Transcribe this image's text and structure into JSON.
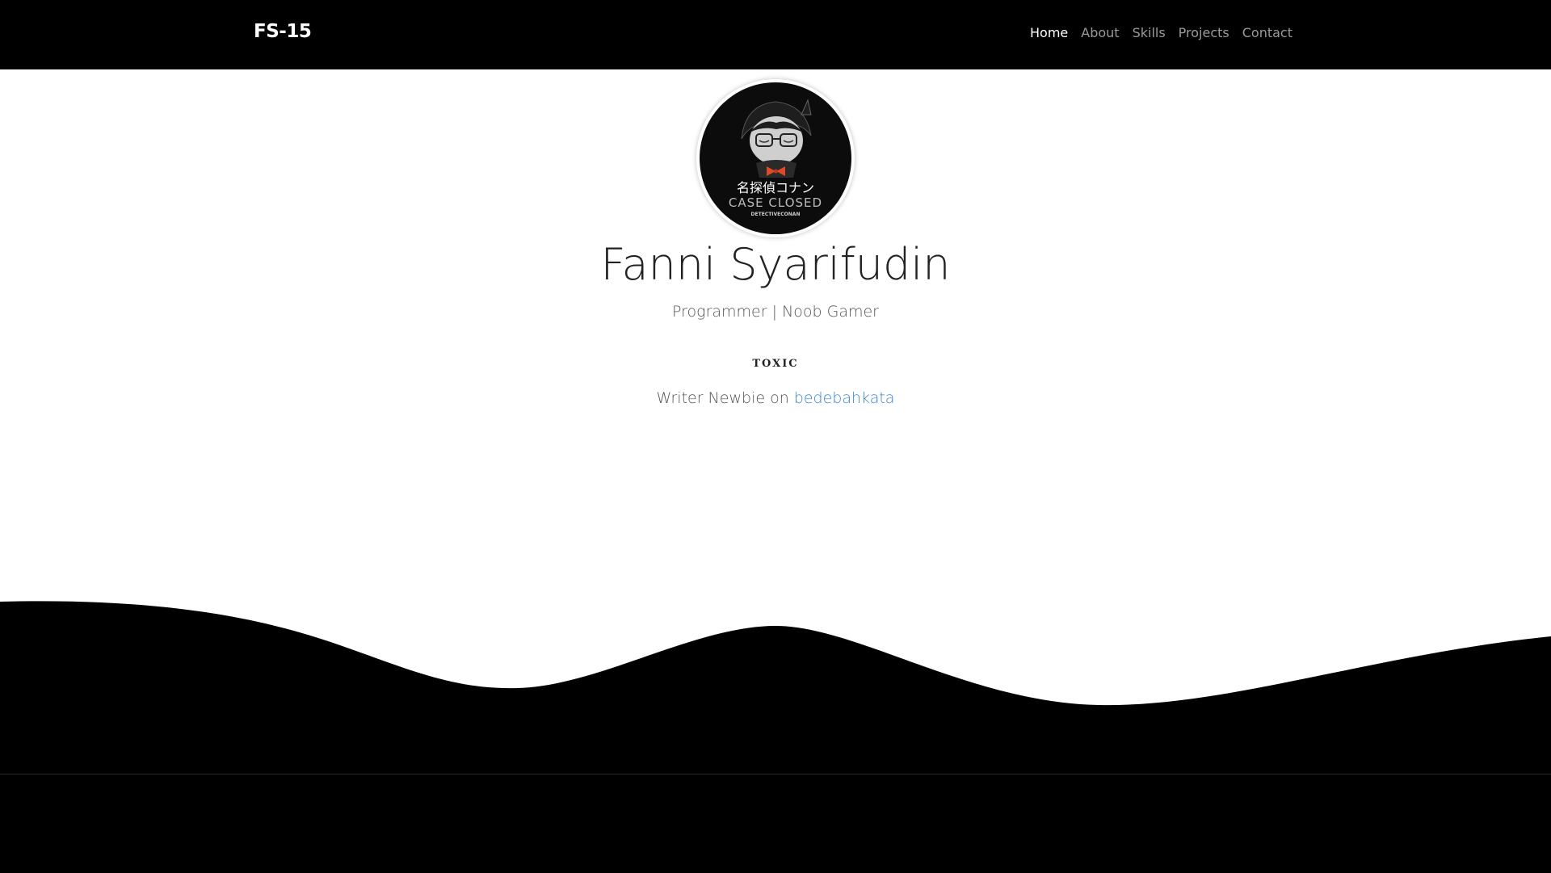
{
  "navbar": {
    "brand": "FS-15",
    "links": [
      {
        "label": "Home",
        "active": true
      },
      {
        "label": "About",
        "active": false
      },
      {
        "label": "Skills",
        "active": false
      },
      {
        "label": "Projects",
        "active": false
      },
      {
        "label": "Contact",
        "active": false
      }
    ]
  },
  "hero": {
    "avatar": {
      "jp_text": "名探偵コナン",
      "en_text": "CASE CLOSED",
      "sub_text": "DETECTIVECONAN"
    },
    "name": "Fanni Syarifudin",
    "tagline": "Programmer | Noob Gamer",
    "badge": "TOXIC",
    "writer_prefix": "Writer Newbie on",
    "writer_link": "bedebahkata"
  },
  "colors": {
    "navbar_bg": "#000000",
    "link_accent": "#3a86d4",
    "wave_fill": "#000000"
  }
}
